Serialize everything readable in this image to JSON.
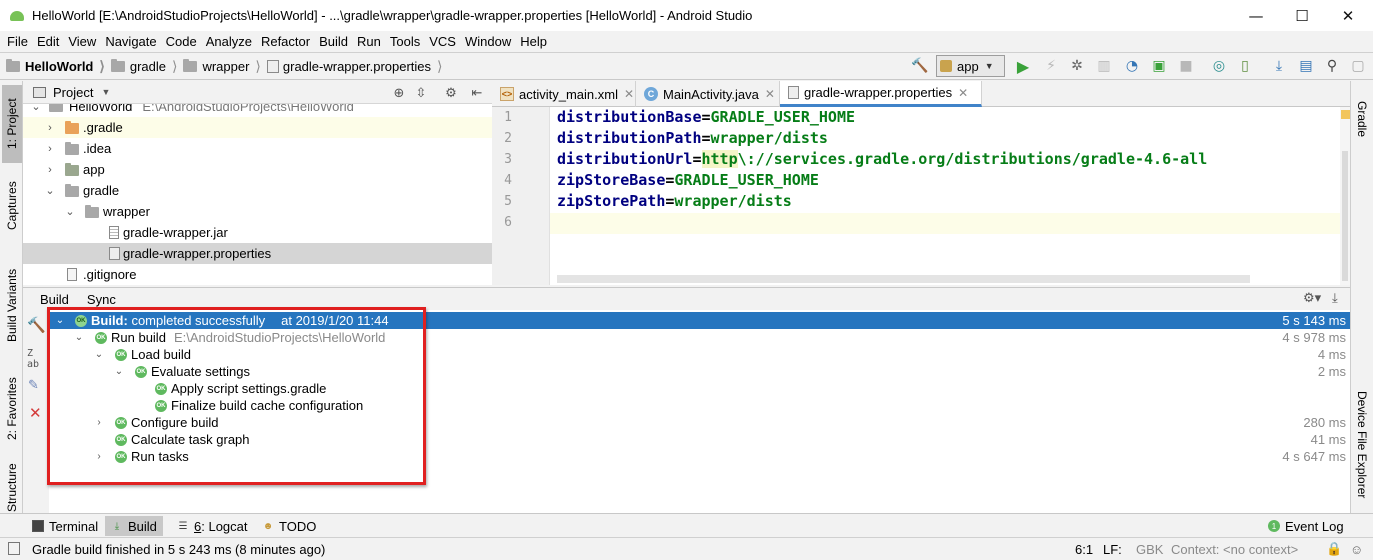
{
  "window": {
    "title": "HelloWorld [E:\\AndroidStudioProjects\\HelloWorld] - ...\\gradle\\wrapper\\gradle-wrapper.properties [HelloWorld] - Android Studio",
    "controls": [
      "—",
      "☐",
      "✕"
    ]
  },
  "menu": [
    "File",
    "Edit",
    "View",
    "Navigate",
    "Code",
    "Analyze",
    "Refactor",
    "Build",
    "Run",
    "Tools",
    "VCS",
    "Window",
    "Help"
  ],
  "breadcrumb": [
    "HelloWorld",
    "gradle",
    "wrapper",
    "gradle-wrapper.properties"
  ],
  "toolbar": {
    "run_config": "app"
  },
  "left_stripe": {
    "project": "1: Project",
    "captures": "Captures",
    "build_variants": "Build Variants",
    "favorites": "2: Favorites",
    "structure": "Structure"
  },
  "right_stripe": {
    "gradle": "Gradle",
    "device_file_explorer": "Device File Explorer"
  },
  "project_panel": {
    "title": "Project",
    "root": {
      "label": "HelloWorld",
      "path": "E:\\AndroidStudioProjects\\HelloWorld"
    },
    "items": [
      {
        "label": ".gradle"
      },
      {
        "label": ".idea"
      },
      {
        "label": "app"
      },
      {
        "label": "gradle"
      },
      {
        "label": "wrapper"
      },
      {
        "label": "gradle-wrapper.jar"
      },
      {
        "label": "gradle-wrapper.properties"
      },
      {
        "label": ".gitignore"
      }
    ]
  },
  "editor": {
    "tabs": [
      "activity_main.xml",
      "MainActivity.java",
      "gradle-wrapper.properties"
    ],
    "line_numbers": [
      "1",
      "2",
      "3",
      "4",
      "5",
      "6"
    ],
    "lines": [
      {
        "key": "distributionBase",
        "value": "GRADLE_USER_HOME"
      },
      {
        "key": "distributionPath",
        "value": "wrapper/dists"
      },
      {
        "key": "distributionUrl",
        "value_http": "http",
        "value_rest": "\\://services.gradle.org/distributions/gradle-4.6-all"
      },
      {
        "key": "zipStoreBase",
        "value": "GRADLE_USER_HOME"
      },
      {
        "key": "zipStorePath",
        "value": "wrapper/dists"
      }
    ]
  },
  "build_panel": {
    "tabs": [
      "Build",
      "Sync"
    ],
    "rows": [
      {
        "label": "Build:",
        "status": "completed successfully",
        "extra": "at 2019/1/20 11:44",
        "time": "5 s 143 ms"
      },
      {
        "label": "Run build",
        "extra": "E:\\AndroidStudioProjects\\HelloWorld",
        "time": "4 s 978 ms"
      },
      {
        "label": "Load build",
        "time": "4 ms"
      },
      {
        "label": "Evaluate settings",
        "time": "2 ms"
      },
      {
        "label": "Apply script settings.gradle",
        "time": ""
      },
      {
        "label": "Finalize build cache configuration",
        "time": ""
      },
      {
        "label": "Configure build",
        "time": "280 ms"
      },
      {
        "label": "Calculate task graph",
        "time": "41 ms"
      },
      {
        "label": "Run tasks",
        "time": "4 s 647 ms"
      }
    ]
  },
  "tool_windows": {
    "terminal": "Terminal",
    "build": "Build",
    "logcat_num": "6",
    "logcat": ": Logcat",
    "todo": "TODO",
    "event_log": "Event Log",
    "event_log_count": "1"
  },
  "status_bar": {
    "message": "Gradle build finished in 5 s 243 ms (8 minutes ago)",
    "position": "6:1",
    "line_sep": "LF:",
    "encoding": "GBK",
    "context": "Context: <no context>"
  },
  "colors": {
    "selection": "#2675bf",
    "keyword": "#000080",
    "value": "#067d17",
    "highlight_box": "#e02020"
  }
}
